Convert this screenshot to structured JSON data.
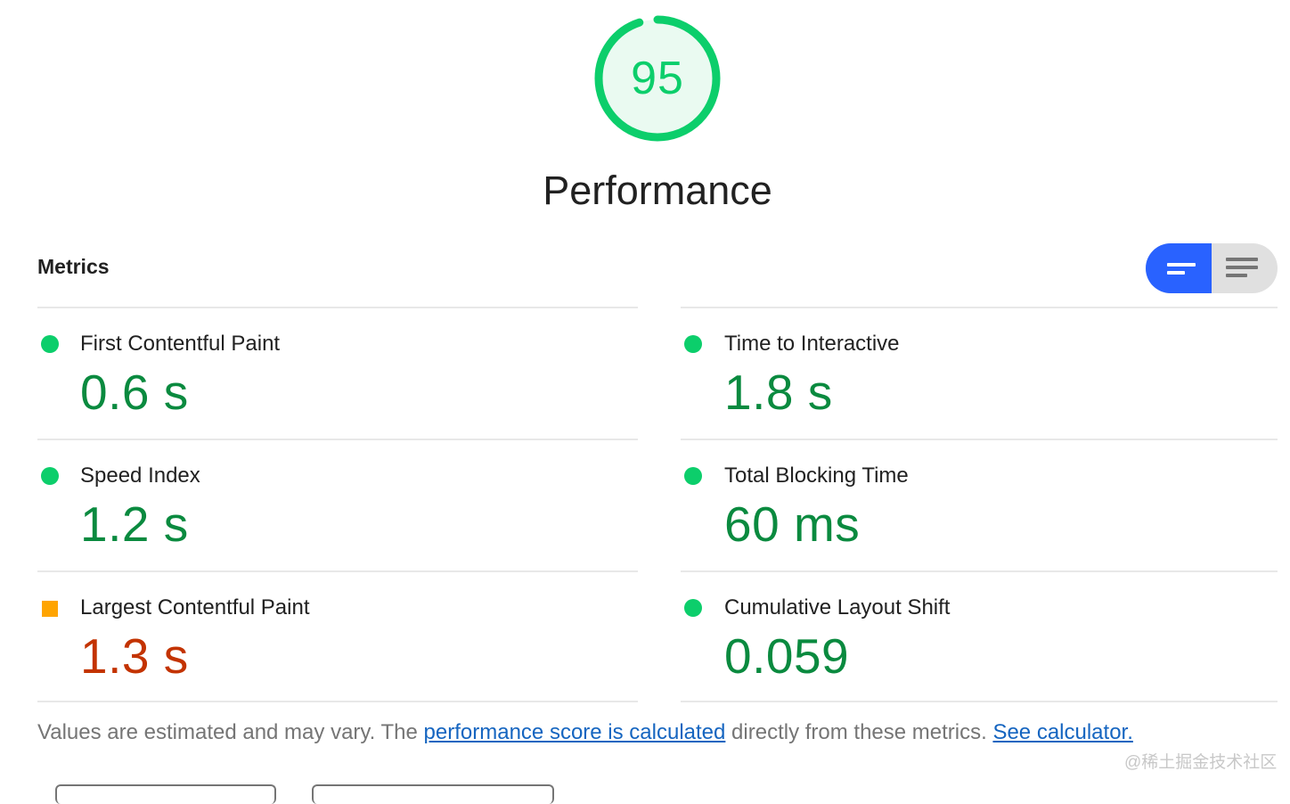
{
  "gauge": {
    "score": "95",
    "color": "#0cce6b",
    "fill_fraction": 0.95
  },
  "title": "Performance",
  "metrics": {
    "heading": "Metrics",
    "items": [
      {
        "label": "First Contentful Paint",
        "value": "0.6 s",
        "status": "pass"
      },
      {
        "label": "Time to Interactive",
        "value": "1.8 s",
        "status": "pass"
      },
      {
        "label": "Speed Index",
        "value": "1.2 s",
        "status": "pass"
      },
      {
        "label": "Total Blocking Time",
        "value": "60 ms",
        "status": "pass"
      },
      {
        "label": "Largest Contentful Paint",
        "value": "1.3 s",
        "status": "average"
      },
      {
        "label": "Cumulative Layout Shift",
        "value": "0.059",
        "status": "pass"
      }
    ]
  },
  "toggle": {
    "active": "compact-view",
    "icons": [
      "compact-view-icon",
      "expanded-view-icon"
    ]
  },
  "footer": {
    "text1": "Values are estimated and may vary. The ",
    "link1": "performance score is calculated",
    "text2": " directly from these metrics. ",
    "link2": "See calculator."
  },
  "watermark": "@稀土掘金技术社区",
  "colors": {
    "pass": "#0cce6b",
    "pass_text": "#0a8a3f",
    "average": "#ffa400",
    "average_text": "#c33300",
    "accent": "#2962ff"
  }
}
